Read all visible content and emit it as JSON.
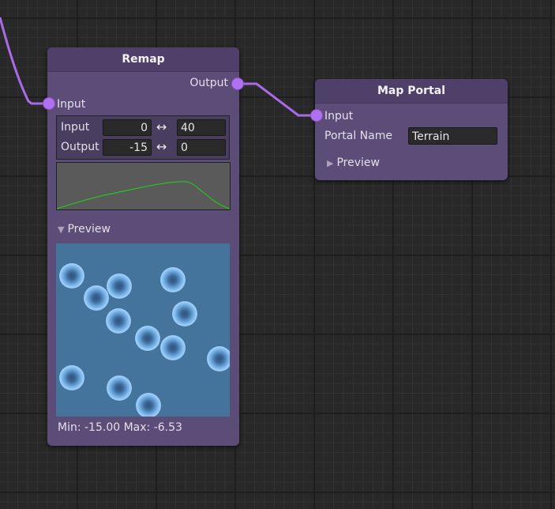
{
  "remap_node": {
    "title": "Remap",
    "output_port_label": "Output",
    "input_port_label": "Input",
    "input_range": {
      "label": "Input",
      "min": "0",
      "max": "40"
    },
    "output_range": {
      "label": "Output",
      "min": "-15",
      "max": "0"
    },
    "range_arrow": "↔",
    "curve_color": "#22c422",
    "preview_label": "Preview",
    "preview_expanded": true,
    "stats": "Min: -15.00 Max: -6.53"
  },
  "map_portal_node": {
    "title": "Map Portal",
    "input_port_label": "Input",
    "portal_name_label": "Portal Name",
    "portal_name_value": "Terrain",
    "preview_label": "Preview",
    "preview_expanded": false
  },
  "colors": {
    "graph_background": "#282828",
    "node_body": "#5b4c78",
    "node_header": "#4e4068",
    "port": "#b071f0",
    "wire": "#a96ae6",
    "preview_background": "#44739c"
  },
  "icons": {
    "range_arrow": "left-right-arrow-icon",
    "foldout_open": "triangle-down-icon",
    "foldout_closed": "triangle-right-icon"
  }
}
